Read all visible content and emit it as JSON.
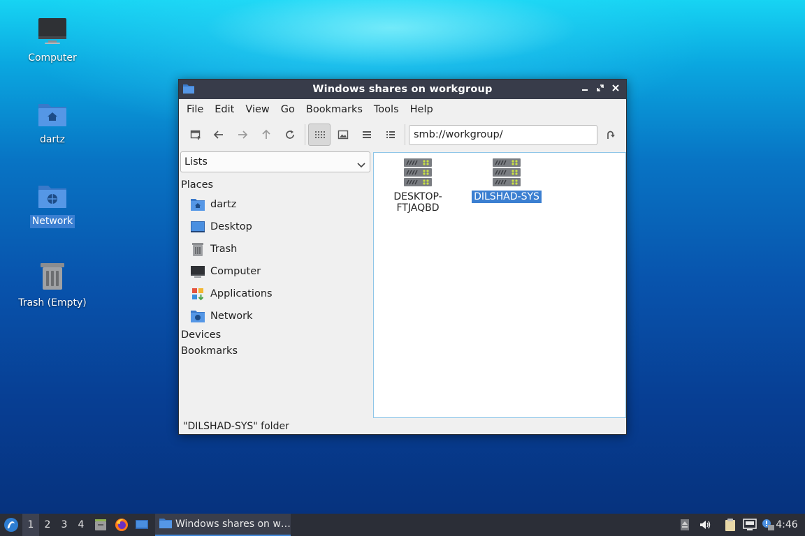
{
  "desktop": {
    "icons": [
      {
        "label": "Computer",
        "icon": "computer-icon"
      },
      {
        "label": "dartz",
        "icon": "home-folder-icon"
      },
      {
        "label": "Network",
        "icon": "network-folder-icon",
        "selected": true
      },
      {
        "label": "Trash (Empty)",
        "icon": "trash-icon"
      }
    ]
  },
  "window": {
    "title": "Windows shares on workgroup",
    "controls": [
      "minimize",
      "maximize",
      "close"
    ],
    "menu": [
      "File",
      "Edit",
      "View",
      "Go",
      "Bookmarks",
      "Tools",
      "Help"
    ],
    "toolbar": {
      "buttons": [
        "new-tab-icon",
        "back-icon",
        "forward-icon",
        "up-icon",
        "reload-icon",
        "icon-view-icon",
        "thumbnail-view-icon",
        "compact-list-icon",
        "detailed-list-icon"
      ],
      "path": "smb://workgroup/",
      "go_icon": "go-icon"
    },
    "sidepane": {
      "selector": "Lists",
      "places_heading": "Places",
      "places": [
        {
          "label": "dartz",
          "icon": "home-folder-icon"
        },
        {
          "label": "Desktop",
          "icon": "desktop-icon"
        },
        {
          "label": "Trash",
          "icon": "trash-icon"
        },
        {
          "label": "Computer",
          "icon": "computer-icon"
        },
        {
          "label": "Applications",
          "icon": "applications-icon"
        },
        {
          "label": "Network",
          "icon": "network-folder-icon"
        }
      ],
      "devices_heading": "Devices",
      "bookmarks_heading": "Bookmarks"
    },
    "content": {
      "items": [
        {
          "label_line1": "DESKTOP-",
          "label_line2": "FTJAQBD",
          "icon": "server-icon",
          "selected": false
        },
        {
          "label": "DILSHAD-SYS",
          "icon": "server-icon",
          "selected": true
        }
      ]
    },
    "status": "\"DILSHAD-SYS\" folder"
  },
  "taskbar": {
    "workspaces": [
      "1",
      "2",
      "3",
      "4"
    ],
    "active_workspace": "1",
    "launchers": [
      "file-manager-icon",
      "firefox-icon",
      "desktop-icon"
    ],
    "task": "Windows shares on w…",
    "tray": [
      "up-arrow-icon",
      "volume-icon",
      "clipboard-icon",
      "network-icon",
      "notification-icon"
    ],
    "clock": "4:46"
  },
  "colors": {
    "selection": "#3b7fd1",
    "titlebar": "#383c4a",
    "taskbar": "#2b2e37",
    "folder_blue": "#4a8fe0"
  }
}
